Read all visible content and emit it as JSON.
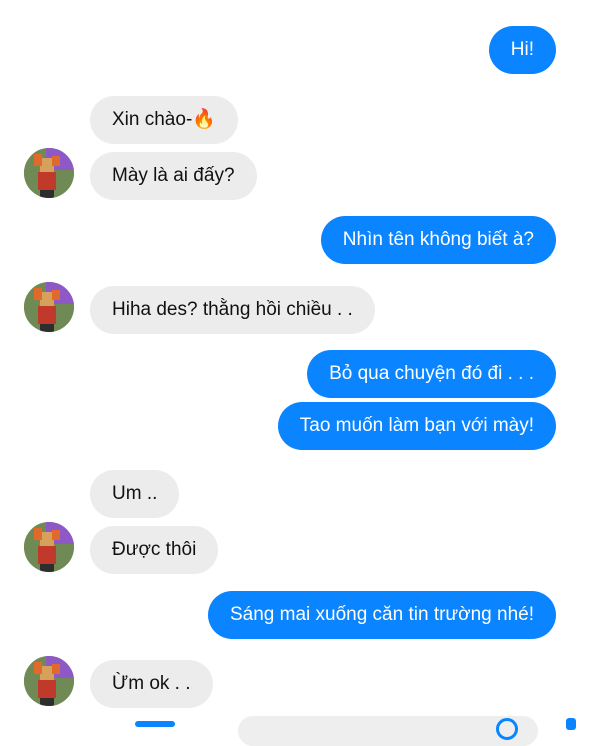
{
  "messages": [
    {
      "from": "me",
      "text": "Hi!"
    },
    {
      "from": "them",
      "text": "Xin chào-🔥"
    },
    {
      "from": "them",
      "text": "Mày là ai đấy?"
    },
    {
      "from": "me",
      "text": "Nhìn tên không biết à?"
    },
    {
      "from": "them",
      "text": "Hiha des? thằng hồi chiều . ."
    },
    {
      "from": "me",
      "text": "Bỏ qua chuyện đó đi . . ."
    },
    {
      "from": "me",
      "text": "Tao muốn làm bạn với mày!"
    },
    {
      "from": "them",
      "text": "Um .."
    },
    {
      "from": "them",
      "text": "Được thôi"
    },
    {
      "from": "me",
      "text": "Sáng mai xuống căn tin trường nhé!"
    },
    {
      "from": "them",
      "text": "Ừm ok . ."
    }
  ],
  "colors": {
    "outgoing": "#0a84ff",
    "incoming": "#ececec"
  },
  "composer": {
    "icons": [
      "camera-icon",
      "emoji-icon",
      "like-icon"
    ]
  }
}
